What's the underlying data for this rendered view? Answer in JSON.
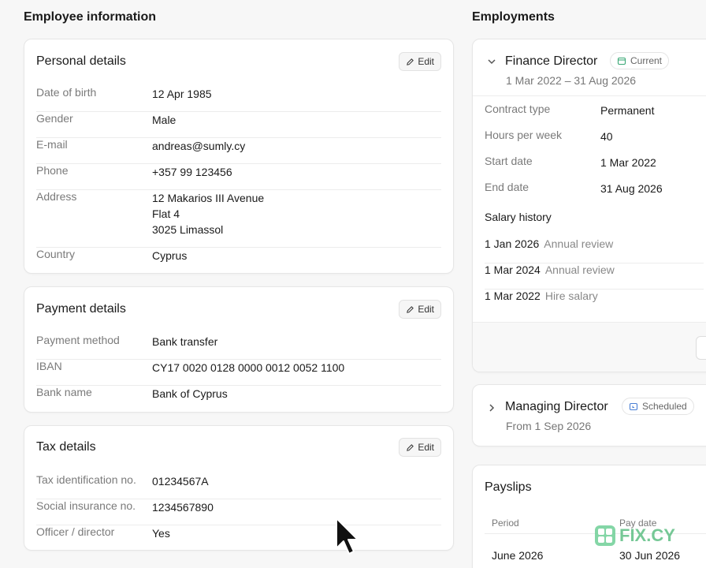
{
  "left": {
    "section_title": "Employee information",
    "personal": {
      "title": "Personal details",
      "edit_label": "Edit",
      "rows": [
        {
          "label": "Date of birth",
          "value": "12 Apr 1985"
        },
        {
          "label": "Gender",
          "value": "Male"
        },
        {
          "label": "E-mail",
          "value": "andreas@sumly.cy"
        },
        {
          "label": "Phone",
          "value": "+357 99 123456"
        },
        {
          "label": "Address",
          "lines": [
            "12 Makarios III Avenue",
            "Flat 4",
            "3025 Limassol"
          ]
        },
        {
          "label": "Country",
          "value": "Cyprus"
        }
      ]
    },
    "payment": {
      "title": "Payment details",
      "edit_label": "Edit",
      "rows": [
        {
          "label": "Payment method",
          "value": "Bank transfer"
        },
        {
          "label": "IBAN",
          "value": "CY17 0020 0128 0000 0012 0052 1100"
        },
        {
          "label": "Bank name",
          "value": "Bank of Cyprus"
        }
      ]
    },
    "tax": {
      "title": "Tax details",
      "edit_label": "Edit",
      "rows": [
        {
          "label": "Tax identification no.",
          "value": "01234567A"
        },
        {
          "label": "Social insurance no.",
          "value": "1234567890"
        },
        {
          "label": "Officer / director",
          "value": "Yes"
        }
      ]
    }
  },
  "right": {
    "section_title": "Employments",
    "current": {
      "title": "Finance Director",
      "badge": "Current",
      "dates": "1 Mar 2022 – 31 Aug 2026",
      "rows": [
        {
          "label": "Contract type",
          "value": "Permanent"
        },
        {
          "label": "Hours per week",
          "value": "40"
        },
        {
          "label": "Start date",
          "value": "1 Mar 2022"
        },
        {
          "label": "End date",
          "value": "31 Aug 2026"
        }
      ],
      "salary_title": "Salary history",
      "salary": [
        {
          "date": "1 Jan 2026",
          "note": "Annual review"
        },
        {
          "date": "1 Mar 2024",
          "note": "Annual review"
        },
        {
          "date": "1 Mar 2022",
          "note": "Hire salary"
        }
      ]
    },
    "scheduled": {
      "title": "Managing Director",
      "badge": "Scheduled",
      "dates": "From 1 Sep 2026"
    },
    "payslips": {
      "title": "Payslips",
      "col_period": "Period",
      "col_paydate": "Pay date",
      "rows": [
        {
          "period": "June 2026",
          "pay_date": "30 Jun 2026"
        }
      ]
    }
  },
  "watermark": "FIX.CY",
  "colors": {
    "current_badge_icon": "#3aa876",
    "scheduled_badge_icon": "#4a7fd4",
    "watermark": "#5fbf84"
  }
}
